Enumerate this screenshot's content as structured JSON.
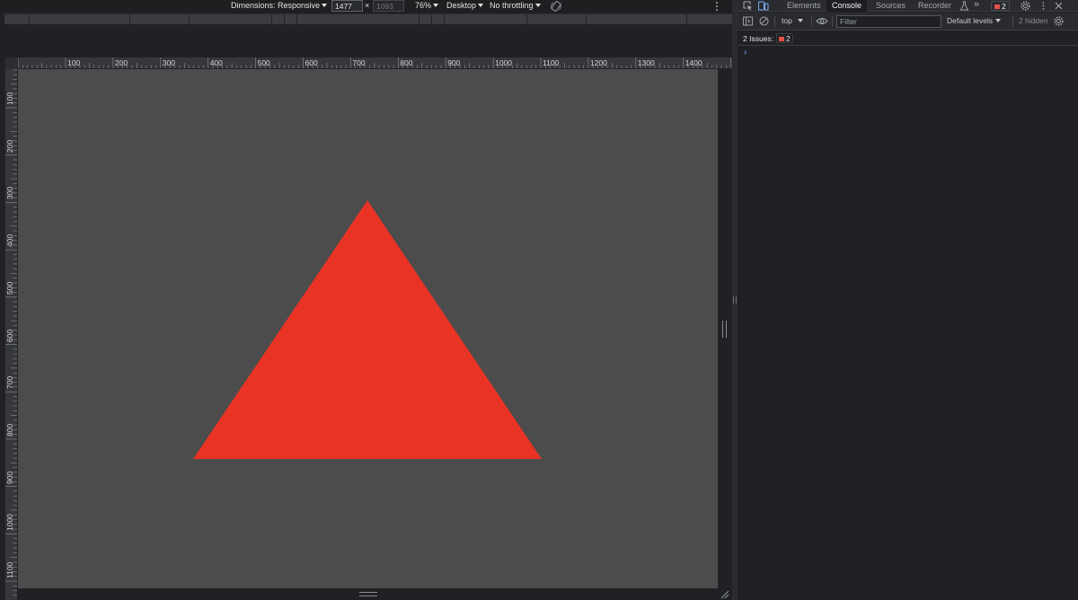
{
  "device_toolbar": {
    "dimensions_label": "Dimensions: Responsive",
    "width_value": "1477",
    "times": "×",
    "height_placeholder": "1093",
    "zoom": "76%",
    "device_type": "Desktop",
    "throttling": "No throttling"
  },
  "rulers": {
    "top": [
      "100",
      "200",
      "300",
      "400",
      "500",
      "600",
      "700",
      "800",
      "900",
      "1000",
      "1100",
      "1200",
      "1300",
      "1400"
    ],
    "left": [
      "100",
      "200",
      "300",
      "400",
      "500",
      "600",
      "700",
      "800",
      "900",
      "1000",
      "1100"
    ]
  },
  "viewport": {
    "background": "#4c4c4c",
    "triangle_color": "#e93325"
  },
  "devtools": {
    "tabs": [
      {
        "label": "Elements",
        "active": false
      },
      {
        "label": "Console",
        "active": true
      },
      {
        "label": "Sources",
        "active": false
      },
      {
        "label": "Recorder",
        "active": false
      }
    ],
    "more_tabs": "»",
    "issues_badge_count": "2",
    "console_toolbar": {
      "context": "top",
      "filter_placeholder": "Filter",
      "levels": "Default levels",
      "hidden": "2 hidden"
    },
    "issues_bar": {
      "label": "2 Issues:",
      "count": "2"
    },
    "prompt": "›"
  },
  "colors": {
    "accent": "#7cacf8",
    "issue_red": "#e4504a"
  }
}
